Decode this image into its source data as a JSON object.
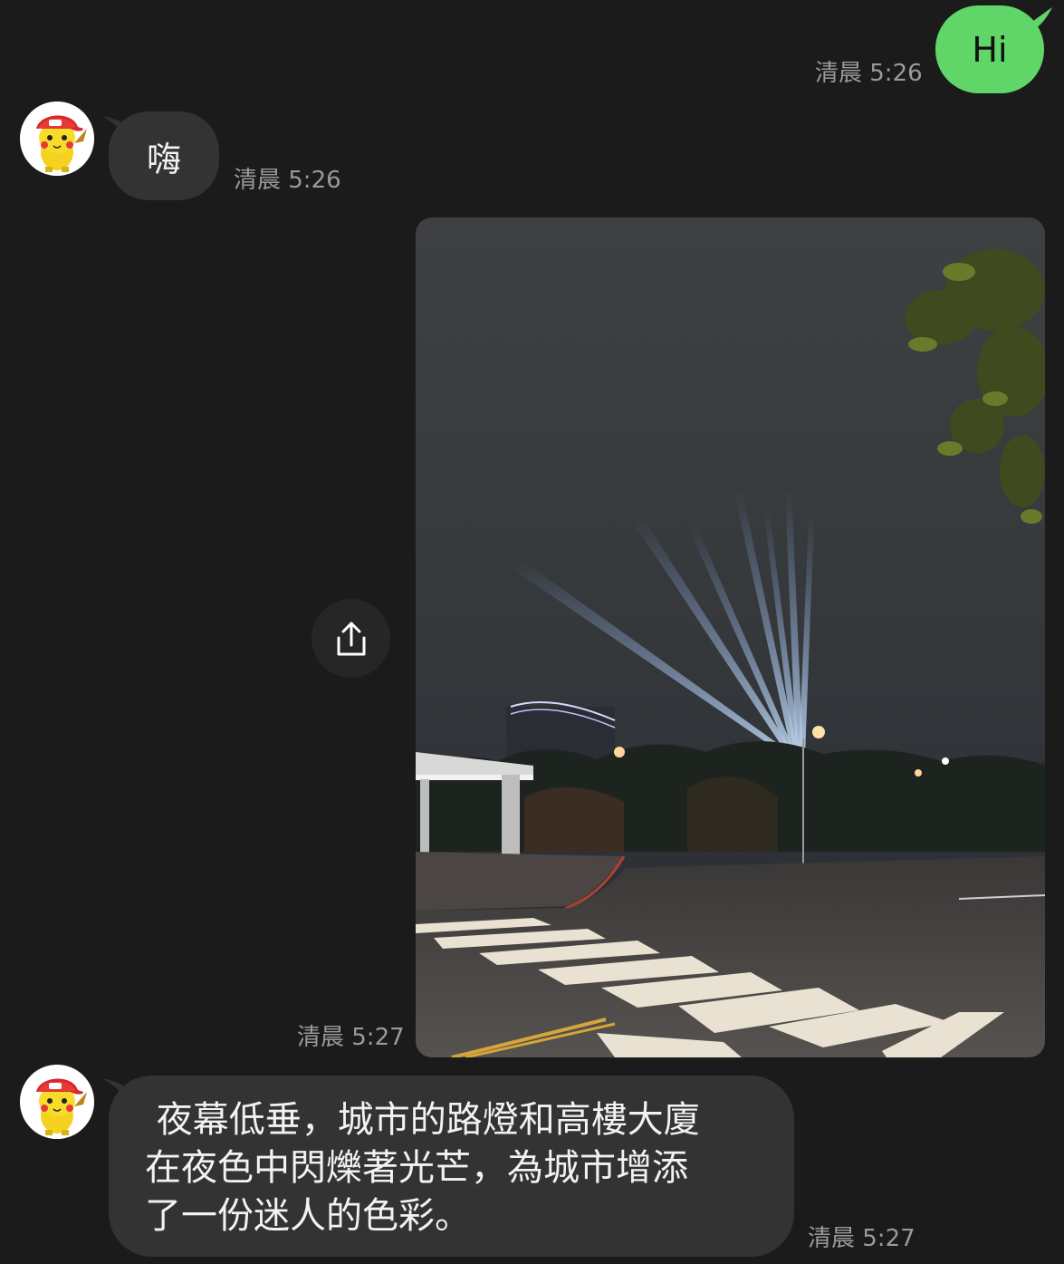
{
  "messages": {
    "m1": {
      "text": "Hi",
      "time": "清晨 5:26"
    },
    "m2": {
      "text": "嗨",
      "time": "清晨 5:26"
    },
    "m3": {
      "time": "清晨 5:27"
    },
    "m4": {
      "line1": " 夜幕低垂，城市的路燈和高樓大廈",
      "line2": "在夜色中閃爍著光芒，為城市增添",
      "line3": "了一份迷人的色彩。",
      "time": "清晨 5:27"
    }
  },
  "icons": {
    "share": "share-icon",
    "avatar": "pikachu-avatar"
  },
  "colors": {
    "background": "#1b1b1b",
    "outgoing_bubble": "#5fd667",
    "incoming_bubble": "#333333",
    "timestamp": "#9a9a9a"
  }
}
